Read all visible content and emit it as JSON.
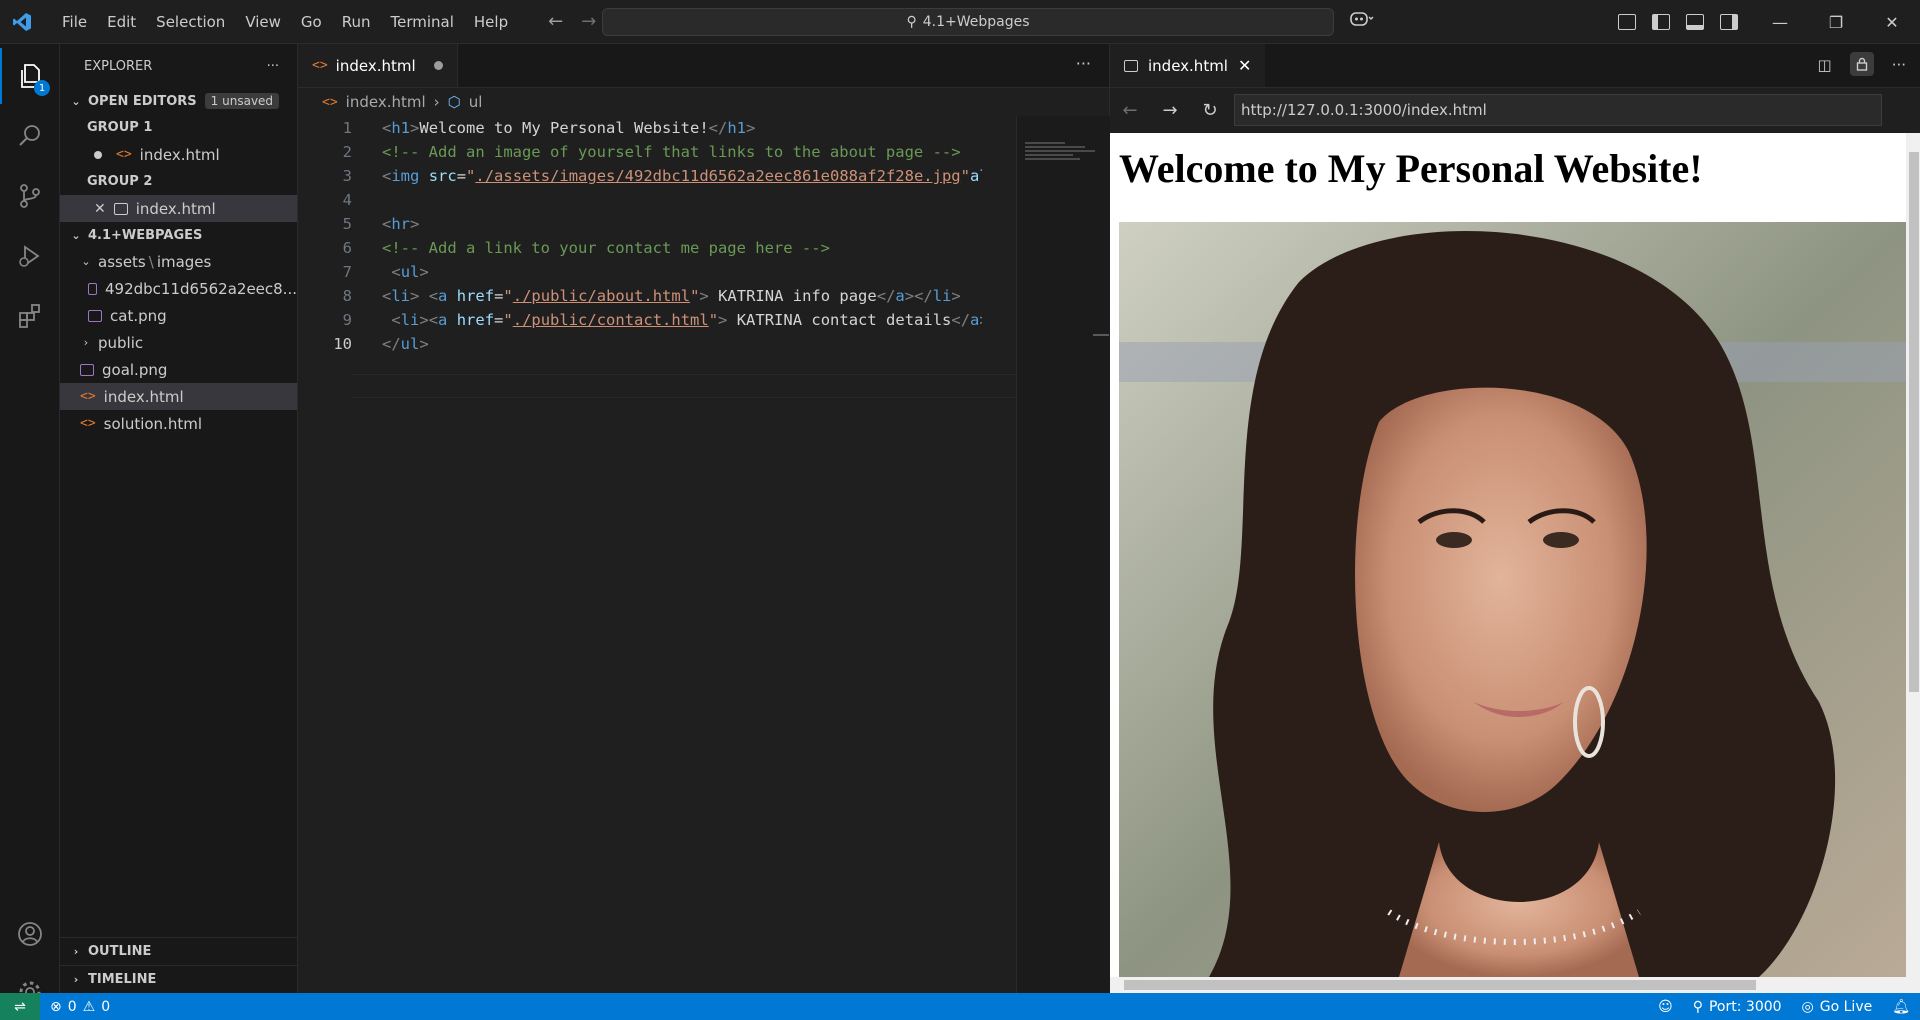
{
  "titlebar": {
    "menu": [
      "File",
      "Edit",
      "Selection",
      "View",
      "Go",
      "Run",
      "Terminal",
      "Help"
    ],
    "search": "4.1+Webpages"
  },
  "activity": {
    "explorer_badge": "1"
  },
  "sidebar": {
    "title": "EXPLORER",
    "open_editors": {
      "label": "OPEN EDITORS",
      "badge": "1 unsaved"
    },
    "group1": {
      "label": "GROUP 1",
      "file": "index.html"
    },
    "group2": {
      "label": "GROUP 2",
      "file": "index.html"
    },
    "project": {
      "label": "4.1+WEBPAGES",
      "folder_assets": "assets",
      "folder_images": "images",
      "files_images": [
        "492dbc11d6562a2eec8...",
        "cat.png"
      ],
      "folder_public": "public",
      "files": [
        "goal.png",
        "index.html",
        "solution.html"
      ]
    },
    "outline": "OUTLINE",
    "timeline": "TIMELINE"
  },
  "editor": {
    "tab": "index.html",
    "breadcrumb": {
      "file": "index.html",
      "symbol": "ul"
    },
    "line_numbers": [
      "1",
      "2",
      "3",
      "4",
      "5",
      "6",
      "7",
      "8",
      "9",
      "10"
    ],
    "current_line": "10"
  },
  "preview": {
    "tab": "index.html",
    "url": "http://127.0.0.1:3000/index.html",
    "page_heading": "Welcome to My Personal Website!"
  },
  "statusbar": {
    "errors": "0",
    "warnings": "0",
    "port": "Port: 3000",
    "golive": "Go Live"
  },
  "colors": {
    "accent": "#0078d4",
    "statusbar": "#0078d4",
    "editor_bg": "#1f1f1f",
    "sidebar_bg": "#181818"
  }
}
